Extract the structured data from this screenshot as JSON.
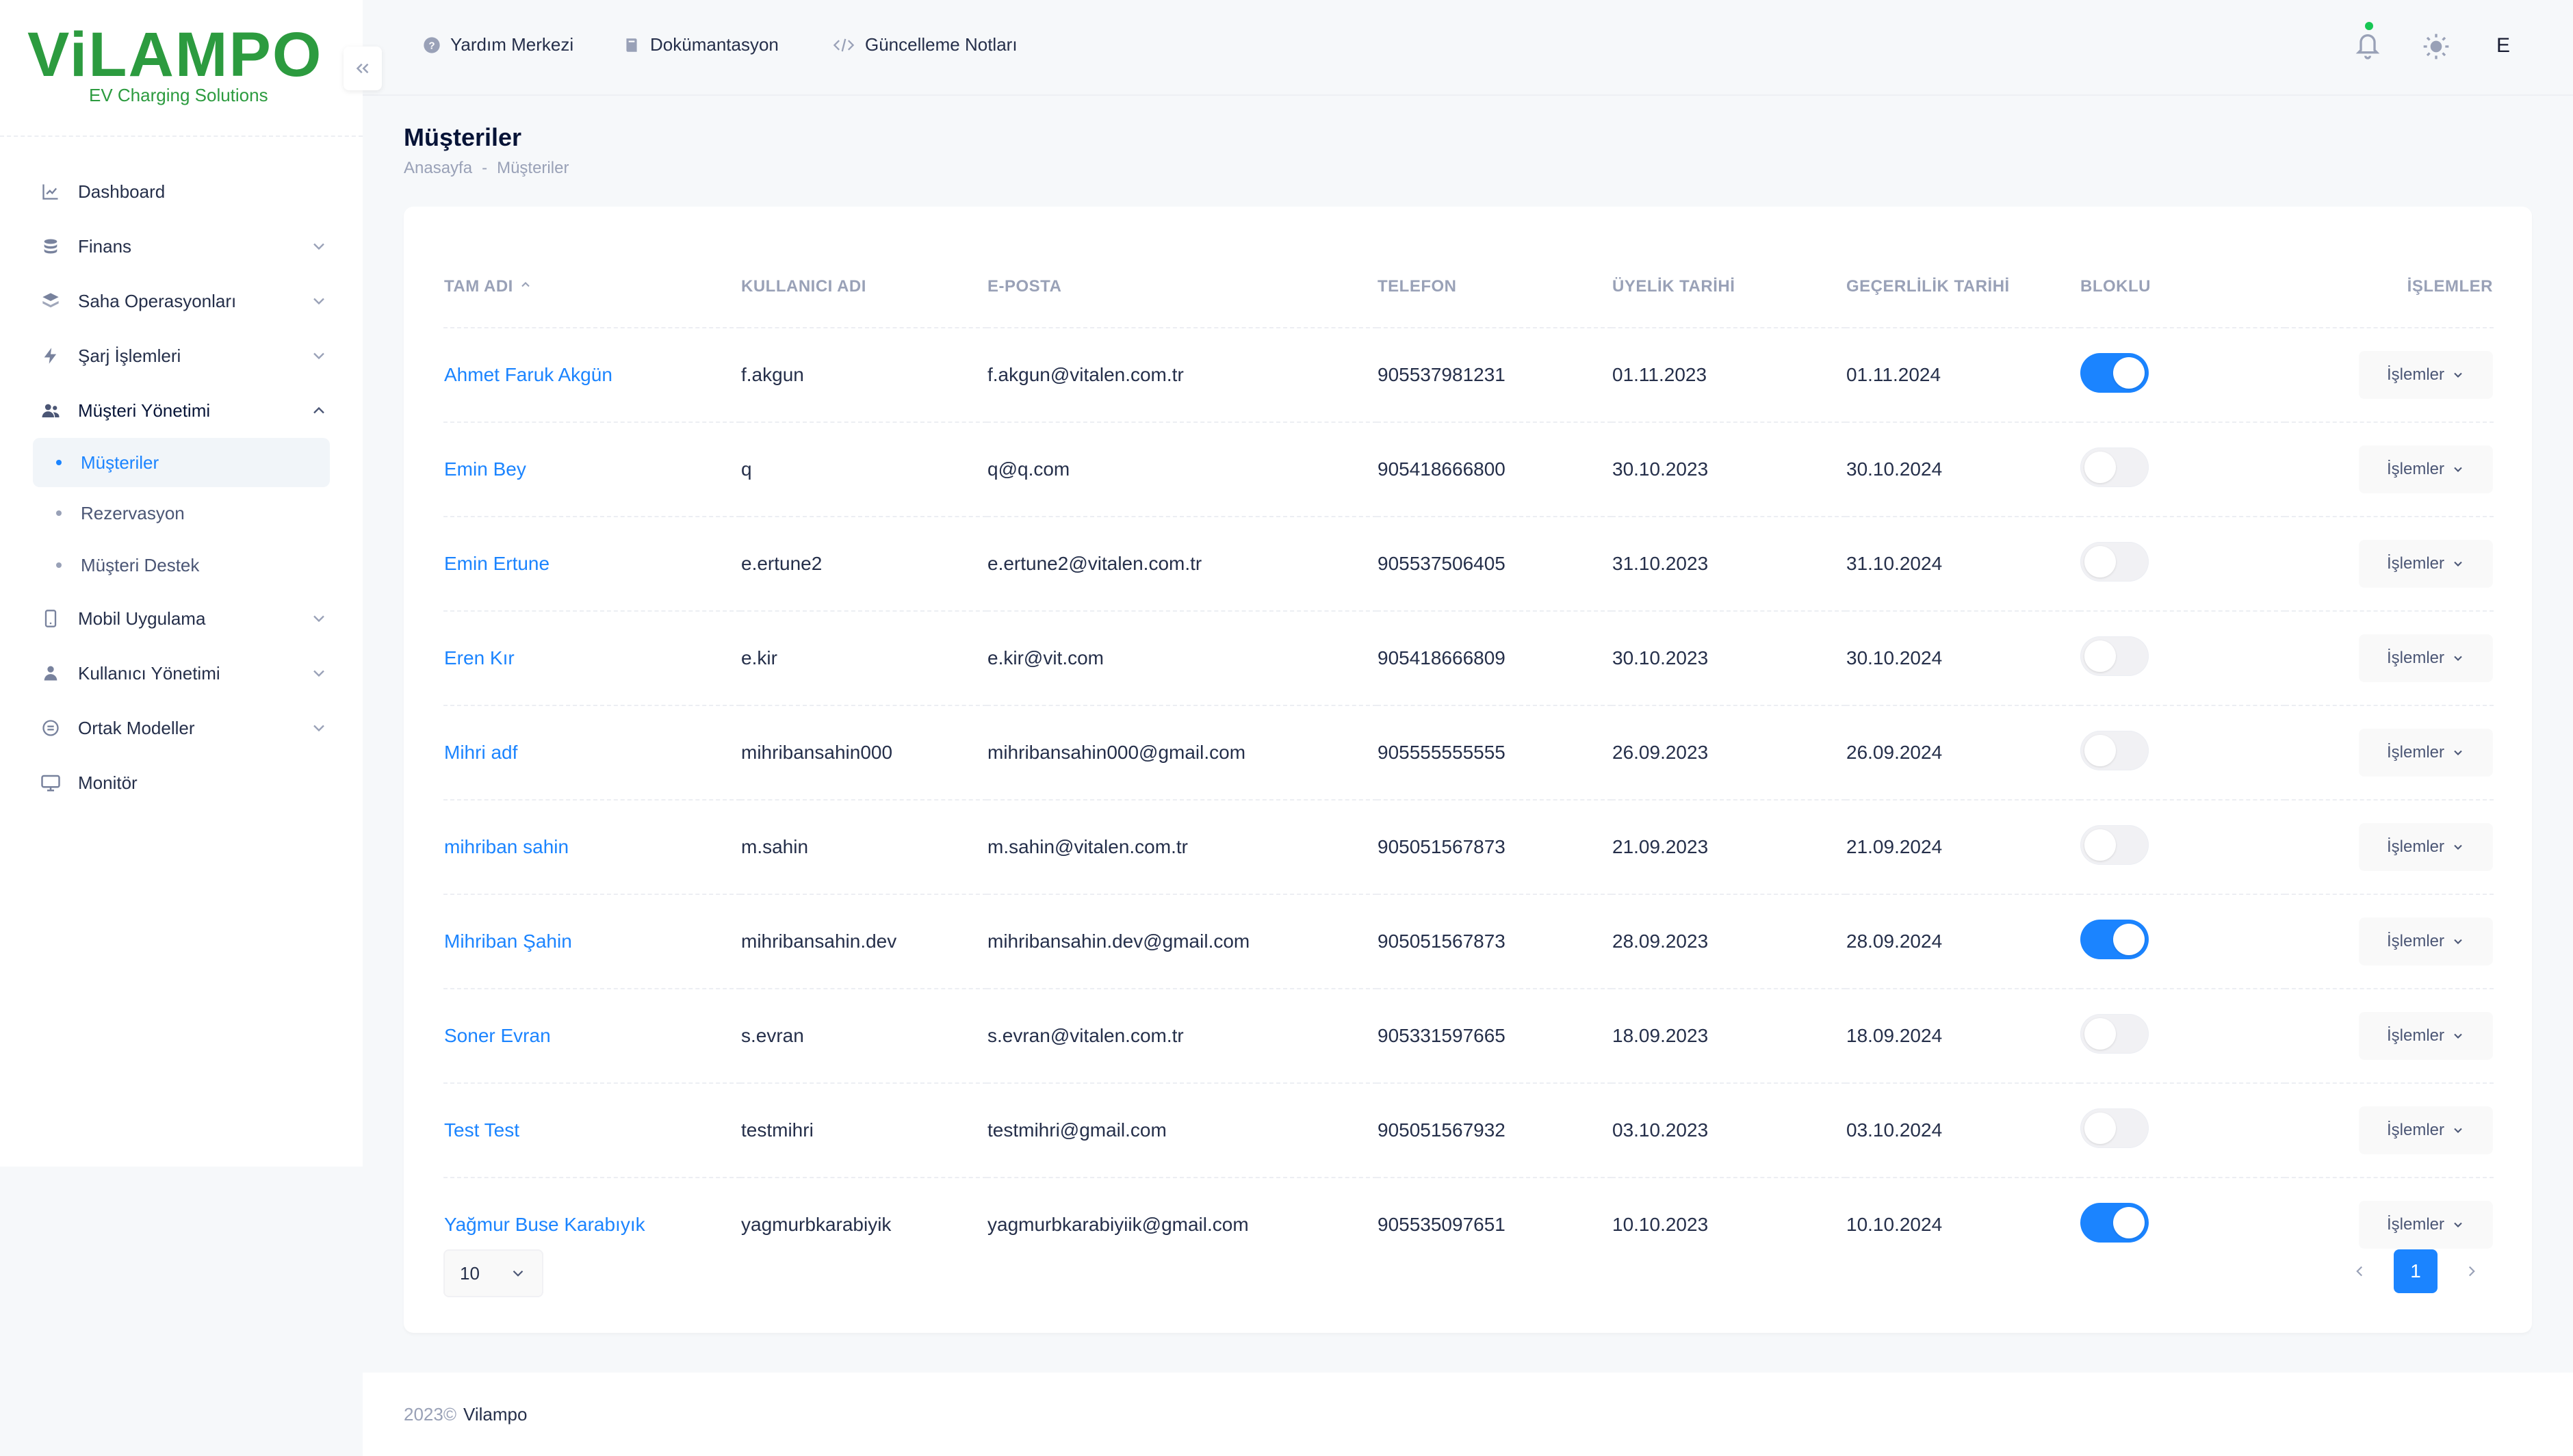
{
  "brand": {
    "logo_text": "ViLAMPO",
    "tagline": "EV Charging Solutions",
    "color": "#2c9b3f"
  },
  "accent_color": "#1b84ff",
  "sidebar": {
    "items": [
      {
        "label": "Dashboard",
        "icon": "chart-line-icon"
      },
      {
        "label": "Finans",
        "icon": "coins-icon",
        "expandable": true
      },
      {
        "label": "Saha Operasyonları",
        "icon": "layers-icon",
        "expandable": true
      },
      {
        "label": "Şarj İşlemleri",
        "icon": "bolt-icon",
        "expandable": true
      },
      {
        "label": "Müşteri Yönetimi",
        "icon": "users-icon",
        "expanded": true,
        "children": [
          {
            "label": "Müşteriler",
            "active": true
          },
          {
            "label": "Rezervasyon"
          },
          {
            "label": "Müşteri Destek"
          }
        ]
      },
      {
        "label": "Mobil Uygulama",
        "icon": "phone-icon",
        "expandable": true
      },
      {
        "label": "Kullanıcı Yönetimi",
        "icon": "user-icon",
        "expandable": true
      },
      {
        "label": "Ortak Modeller",
        "icon": "circle-list-icon",
        "expandable": true
      },
      {
        "label": "Monitör",
        "icon": "monitor-icon"
      }
    ]
  },
  "header": {
    "links": [
      {
        "label": "Yardım Merkezi",
        "icon": "help-circle-icon"
      },
      {
        "label": "Dokümantasyon",
        "icon": "book-icon"
      },
      {
        "label": "Güncelleme Notları",
        "icon": "code-icon"
      }
    ],
    "user_initial": "E"
  },
  "page": {
    "title": "Müşteriler",
    "breadcrumb": [
      "Anasayfa",
      "-",
      "Müşteriler"
    ]
  },
  "table": {
    "columns": [
      "TAM ADI",
      "KULLANICI ADI",
      "E-POSTA",
      "TELEFON",
      "ÜYELİK TARİHİ",
      "GEÇERLİLİK TARİHİ",
      "BLOKLU",
      "İŞLEMLER"
    ],
    "action_label": "İşlemler",
    "rows": [
      {
        "name": "Ahmet Faruk Akgün",
        "username": "f.akgun",
        "email": "f.akgun@vitalen.com.tr",
        "phone": "905537981231",
        "joined": "01.11.2023",
        "valid": "01.11.2024",
        "blocked": true
      },
      {
        "name": "Emin Bey",
        "username": "q",
        "email": "q@q.com",
        "phone": "905418666800",
        "joined": "30.10.2023",
        "valid": "30.10.2024",
        "blocked": false
      },
      {
        "name": "Emin Ertune",
        "username": "e.ertune2",
        "email": "e.ertune2@vitalen.com.tr",
        "phone": "905537506405",
        "joined": "31.10.2023",
        "valid": "31.10.2024",
        "blocked": false
      },
      {
        "name": "Eren Kır",
        "username": "e.kir",
        "email": "e.kir@vit.com",
        "phone": "905418666809",
        "joined": "30.10.2023",
        "valid": "30.10.2024",
        "blocked": false
      },
      {
        "name": "Mihri adf",
        "username": "mihribansahin000",
        "email": "mihribansahin000@gmail.com",
        "phone": "905555555555",
        "joined": "26.09.2023",
        "valid": "26.09.2024",
        "blocked": false
      },
      {
        "name": "mihriban sahin",
        "username": "m.sahin",
        "email": "m.sahin@vitalen.com.tr",
        "phone": "905051567873",
        "joined": "21.09.2023",
        "valid": "21.09.2024",
        "blocked": false
      },
      {
        "name": "Mihriban Şahin",
        "username": "mihribansahin.dev",
        "email": "mihribansahin.dev@gmail.com",
        "phone": "905051567873",
        "joined": "28.09.2023",
        "valid": "28.09.2024",
        "blocked": true
      },
      {
        "name": "Soner Evran",
        "username": "s.evran",
        "email": "s.evran@vitalen.com.tr",
        "phone": "905331597665",
        "joined": "18.09.2023",
        "valid": "18.09.2024",
        "blocked": false
      },
      {
        "name": "Test Test",
        "username": "testmihri",
        "email": "testmihri@gmail.com",
        "phone": "905051567932",
        "joined": "03.10.2023",
        "valid": "03.10.2024",
        "blocked": false
      },
      {
        "name": "Yağmur Buse Karabıyık",
        "username": "yagmurbkarabiyik",
        "email": "yagmurbkarabiyiik@gmail.com",
        "phone": "905535097651",
        "joined": "10.10.2023",
        "valid": "10.10.2024",
        "blocked": true
      }
    ]
  },
  "pagination": {
    "page_size": "10",
    "current_page": "1"
  },
  "footer": {
    "year": "2023©",
    "brand": "Vilampo"
  }
}
